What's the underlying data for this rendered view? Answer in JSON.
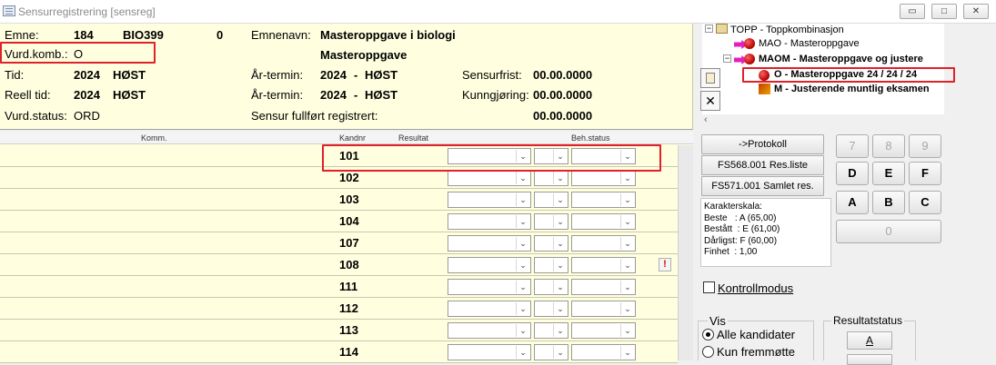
{
  "window": {
    "title": "Sensurregistrering [sensreg]",
    "min": "▭",
    "max": "□",
    "close": "✕"
  },
  "header": {
    "emne_label": "Emne:",
    "emne_kode": "184",
    "emne_id": "BIO399",
    "emne_ver": "0",
    "emnenavn_label": "Emnenavn:",
    "emnenavn": "Masteroppgave i biologi",
    "vurdkomb_label": "Vurd.komb.:",
    "vurdkomb": "O",
    "vurd_navn": "Masteroppgave",
    "tid_label": "Tid:",
    "tid_aar": "2024",
    "tid_termin": "HØST",
    "aartermin_label": "År-termin:",
    "at1_aar": "2024",
    "dash": "-",
    "at1_termin": "HØST",
    "sensurfrist_label": "Sensurfrist:",
    "sensurfrist": "00.00.0000",
    "reell_label": "Reell tid:",
    "reell_aar": "2024",
    "reell_termin": "HØST",
    "at2_aar": "2024",
    "at2_termin": "HØST",
    "kunngjoring_label": "Kunngjøring:",
    "kunngjoring": "00.00.0000",
    "vurdstatus_label": "Vurd.status:",
    "vurdstatus": "ORD",
    "sensur_label": "Sensur fullført registrert:",
    "sensur_dato": "00.00.0000"
  },
  "grid": {
    "col_komm": "Komm.",
    "col_kandnr": "Kandnr",
    "col_resultat": "Resultat",
    "col_beh": "Beh.status",
    "rows": [
      {
        "kandnr": "101",
        "warn": ""
      },
      {
        "kandnr": "102",
        "warn": ""
      },
      {
        "kandnr": "103",
        "warn": ""
      },
      {
        "kandnr": "104",
        "warn": ""
      },
      {
        "kandnr": "107",
        "warn": ""
      },
      {
        "kandnr": "108",
        "warn": "!"
      },
      {
        "kandnr": "111",
        "warn": ""
      },
      {
        "kandnr": "112",
        "warn": ""
      },
      {
        "kandnr": "113",
        "warn": ""
      },
      {
        "kandnr": "114",
        "warn": ""
      }
    ]
  },
  "tree": {
    "root": "TOPP - Toppkombinasjon",
    "mao": "MAO - Masteroppgave",
    "maom": "MAOM - Masteroppgave og justere",
    "o": "O - Masteroppgave 24 / 24 / 24",
    "m": "M - Justerende muntlig eksamen"
  },
  "buttons": {
    "protokoll": "->Protokoll",
    "resliste": "FS568.001 Res.liste",
    "samlet": "FS571.001 Samlet res."
  },
  "keypad": {
    "k7": "7",
    "k8": "8",
    "k9": "9",
    "kD": "D",
    "kE": "E",
    "kF": "F",
    "kA": "A",
    "kB": "B",
    "kC": "C",
    "k0": "0"
  },
  "karakterskala": {
    "title": "Karakterskala:",
    "beste": "Beste   : A (65,00)",
    "bestatt": "Bestått  : E (61,00)",
    "darligst": "Dårligst: F (60,00)",
    "finhet": "Finhet  : 1,00"
  },
  "kontrollmodus": "Kontrollmodus",
  "vis": {
    "title": "Vis",
    "alle": "Alle kandidater",
    "kun": "Kun fremmøtte"
  },
  "resultatstatus": {
    "title": "Resultatstatus",
    "a": "A"
  }
}
